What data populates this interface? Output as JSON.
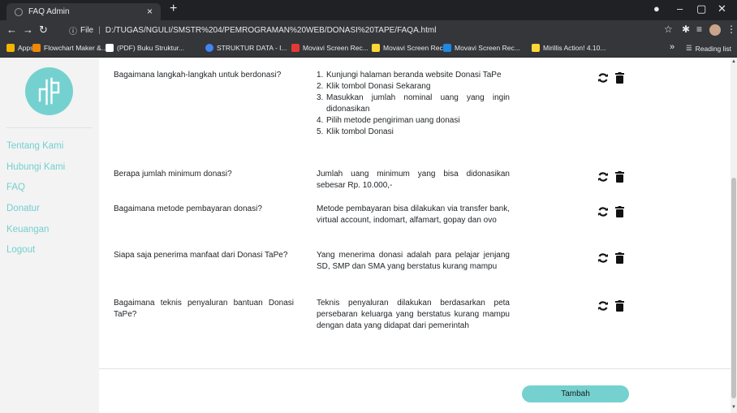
{
  "browser": {
    "tab_title": "FAQ Admin",
    "tab_close": "×",
    "new_tab": "+",
    "url_scheme_label": "File",
    "url_text": "D:/TUGAS/NGULI/SMSTR%204/PEMROGRAMAN%20WEB/DONASI%20TAPE/FAQA.html",
    "bookmarks": [
      {
        "label": "Apps",
        "color": "#f4b400"
      },
      {
        "label": "Flowchart Maker &...",
        "color": "#f08705"
      },
      {
        "label": "(PDF) Buku Struktur...",
        "color": "#ffffff"
      },
      {
        "label": "STRUKTUR DATA - I...",
        "color": "#4285f4"
      },
      {
        "label": "Movavi Screen Rec...",
        "color": "#e53935"
      },
      {
        "label": "Movavi Screen Rec...",
        "color": "#fdd835"
      },
      {
        "label": "Movavi Screen Rec...",
        "color": "#1e88e5"
      },
      {
        "label": "Mirillis Action! 4.10...",
        "color": "#fdd835"
      }
    ],
    "more_bookmarks": "»",
    "reading_list": "Reading list"
  },
  "sidebar": {
    "brand_color": "#74d1d0",
    "nav": [
      {
        "label": "Tentang Kami"
      },
      {
        "label": "Hubungi Kami"
      },
      {
        "label": "FAQ"
      },
      {
        "label": "Donatur"
      },
      {
        "label": "Keuangan"
      },
      {
        "label": "Logout"
      }
    ]
  },
  "faq": [
    {
      "question": "Bagaimana langkah-langkah untuk berdonasi?",
      "steps": [
        {
          "n": "1.",
          "text": "Kunjungi halaman beranda website Donasi TaPe"
        },
        {
          "n": "2.",
          "text": "Klik tombol Donasi Sekarang"
        },
        {
          "n": "3.",
          "text": "Masukkan jumlah nominal uang yang ingin didonasikan"
        },
        {
          "n": "4.",
          "text": "Pilih metode pengiriman uang donasi"
        },
        {
          "n": "5.",
          "text": "Klik tombol Donasi"
        }
      ]
    },
    {
      "question": "Berapa jumlah minimum donasi?",
      "answer": "Jumlah uang minimum yang bisa didonasikan sebesar Rp. 10.000,-"
    },
    {
      "question": "Bagaimana metode pembayaran donasi?",
      "answer": "Metode pembayaran bisa dilakukan via transfer bank, virtual account, indomart, alfamart, gopay dan ovo"
    },
    {
      "question": "Siapa saja penerima manfaat dari Donasi TaPe?",
      "answer": "Yang menerima donasi adalah para pelajar jenjang SD, SMP dan SMA yang berstatus kurang mampu"
    },
    {
      "question": "Bagaimana teknis penyaluran bantuan Donasi TaPe?",
      "answer": "Teknis penyaluran dilakukan berdasarkan peta persebaran keluarga yang berstatus kurang mampu dengan data yang didapat dari pemerintah"
    }
  ],
  "actions": {
    "add_label": "Tambah",
    "accent": "#74d1d0"
  }
}
